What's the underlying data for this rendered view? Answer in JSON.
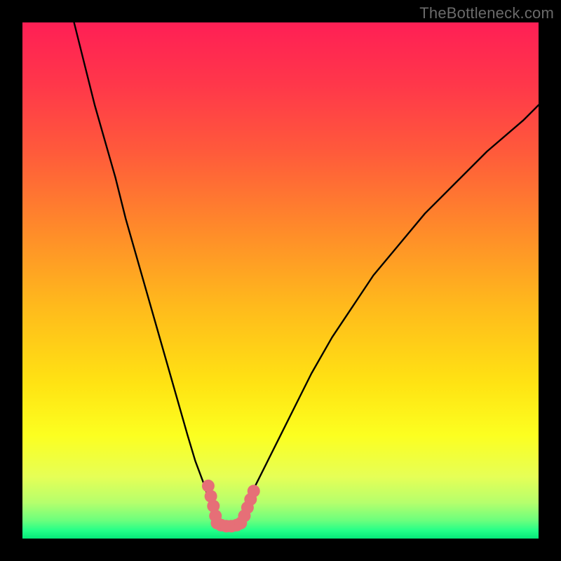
{
  "watermark": "TheBottleneck.com",
  "colors": {
    "frame": "#000000",
    "curve": "#000000",
    "marker": "#e66f77",
    "gradient_stops": [
      {
        "offset": 0.0,
        "color": "#ff1f55"
      },
      {
        "offset": 0.12,
        "color": "#ff374a"
      },
      {
        "offset": 0.25,
        "color": "#ff5a3b"
      },
      {
        "offset": 0.4,
        "color": "#ff8a2a"
      },
      {
        "offset": 0.55,
        "color": "#ffba1c"
      },
      {
        "offset": 0.7,
        "color": "#ffe313"
      },
      {
        "offset": 0.8,
        "color": "#fcff20"
      },
      {
        "offset": 0.88,
        "color": "#e6ff56"
      },
      {
        "offset": 0.93,
        "color": "#b6ff6c"
      },
      {
        "offset": 0.965,
        "color": "#6bff7d"
      },
      {
        "offset": 0.985,
        "color": "#22ff88"
      },
      {
        "offset": 1.0,
        "color": "#05e879"
      }
    ]
  },
  "chart_data": {
    "type": "line",
    "title": "",
    "xlabel": "",
    "ylabel": "",
    "xlim": [
      0,
      100
    ],
    "ylim": [
      0,
      100
    ],
    "legend": false,
    "grid": false,
    "series": [
      {
        "name": "bottleneck-curve-left",
        "x": [
          10,
          12,
          14,
          16,
          18,
          20,
          22,
          24,
          26,
          28,
          30,
          32,
          33.5,
          35,
          36,
          37,
          37.7
        ],
        "y": [
          100,
          92,
          84,
          77,
          70,
          62,
          55,
          48,
          41,
          34,
          27,
          20,
          15,
          11,
          8,
          5,
          3.0
        ]
      },
      {
        "name": "bottleneck-curve-right",
        "x": [
          42.3,
          43,
          44,
          45.5,
          47.5,
          50,
          53,
          56,
          60,
          64,
          68,
          73,
          78,
          84,
          90,
          97,
          100
        ],
        "y": [
          3.0,
          5,
          8,
          11,
          15,
          20,
          26,
          32,
          39,
          45,
          51,
          57,
          63,
          69,
          75,
          81,
          84
        ]
      },
      {
        "name": "curve-floor",
        "x": [
          37.7,
          38.5,
          39.5,
          40.5,
          41.5,
          42.3
        ],
        "y": [
          3.0,
          2.6,
          2.4,
          2.4,
          2.6,
          3.0
        ]
      }
    ],
    "markers": [
      {
        "name": "left-marker-1",
        "x": 36.0,
        "y": 10.2
      },
      {
        "name": "left-marker-2",
        "x": 36.5,
        "y": 8.2
      },
      {
        "name": "left-marker-3",
        "x": 37.0,
        "y": 6.3
      },
      {
        "name": "left-marker-4",
        "x": 37.4,
        "y": 4.4
      },
      {
        "name": "left-marker-5",
        "x": 37.7,
        "y": 3.0
      },
      {
        "name": "floor-marker-1",
        "x": 38.5,
        "y": 2.6
      },
      {
        "name": "floor-marker-2",
        "x": 39.5,
        "y": 2.4
      },
      {
        "name": "floor-marker-3",
        "x": 40.5,
        "y": 2.4
      },
      {
        "name": "floor-marker-4",
        "x": 41.5,
        "y": 2.6
      },
      {
        "name": "right-marker-1",
        "x": 42.3,
        "y": 3.0
      },
      {
        "name": "right-marker-2",
        "x": 43.0,
        "y": 4.4
      },
      {
        "name": "right-marker-3",
        "x": 43.6,
        "y": 6.0
      },
      {
        "name": "right-marker-4",
        "x": 44.2,
        "y": 7.6
      },
      {
        "name": "right-marker-5",
        "x": 44.8,
        "y": 9.2
      }
    ],
    "marker_radius_px": 9
  }
}
